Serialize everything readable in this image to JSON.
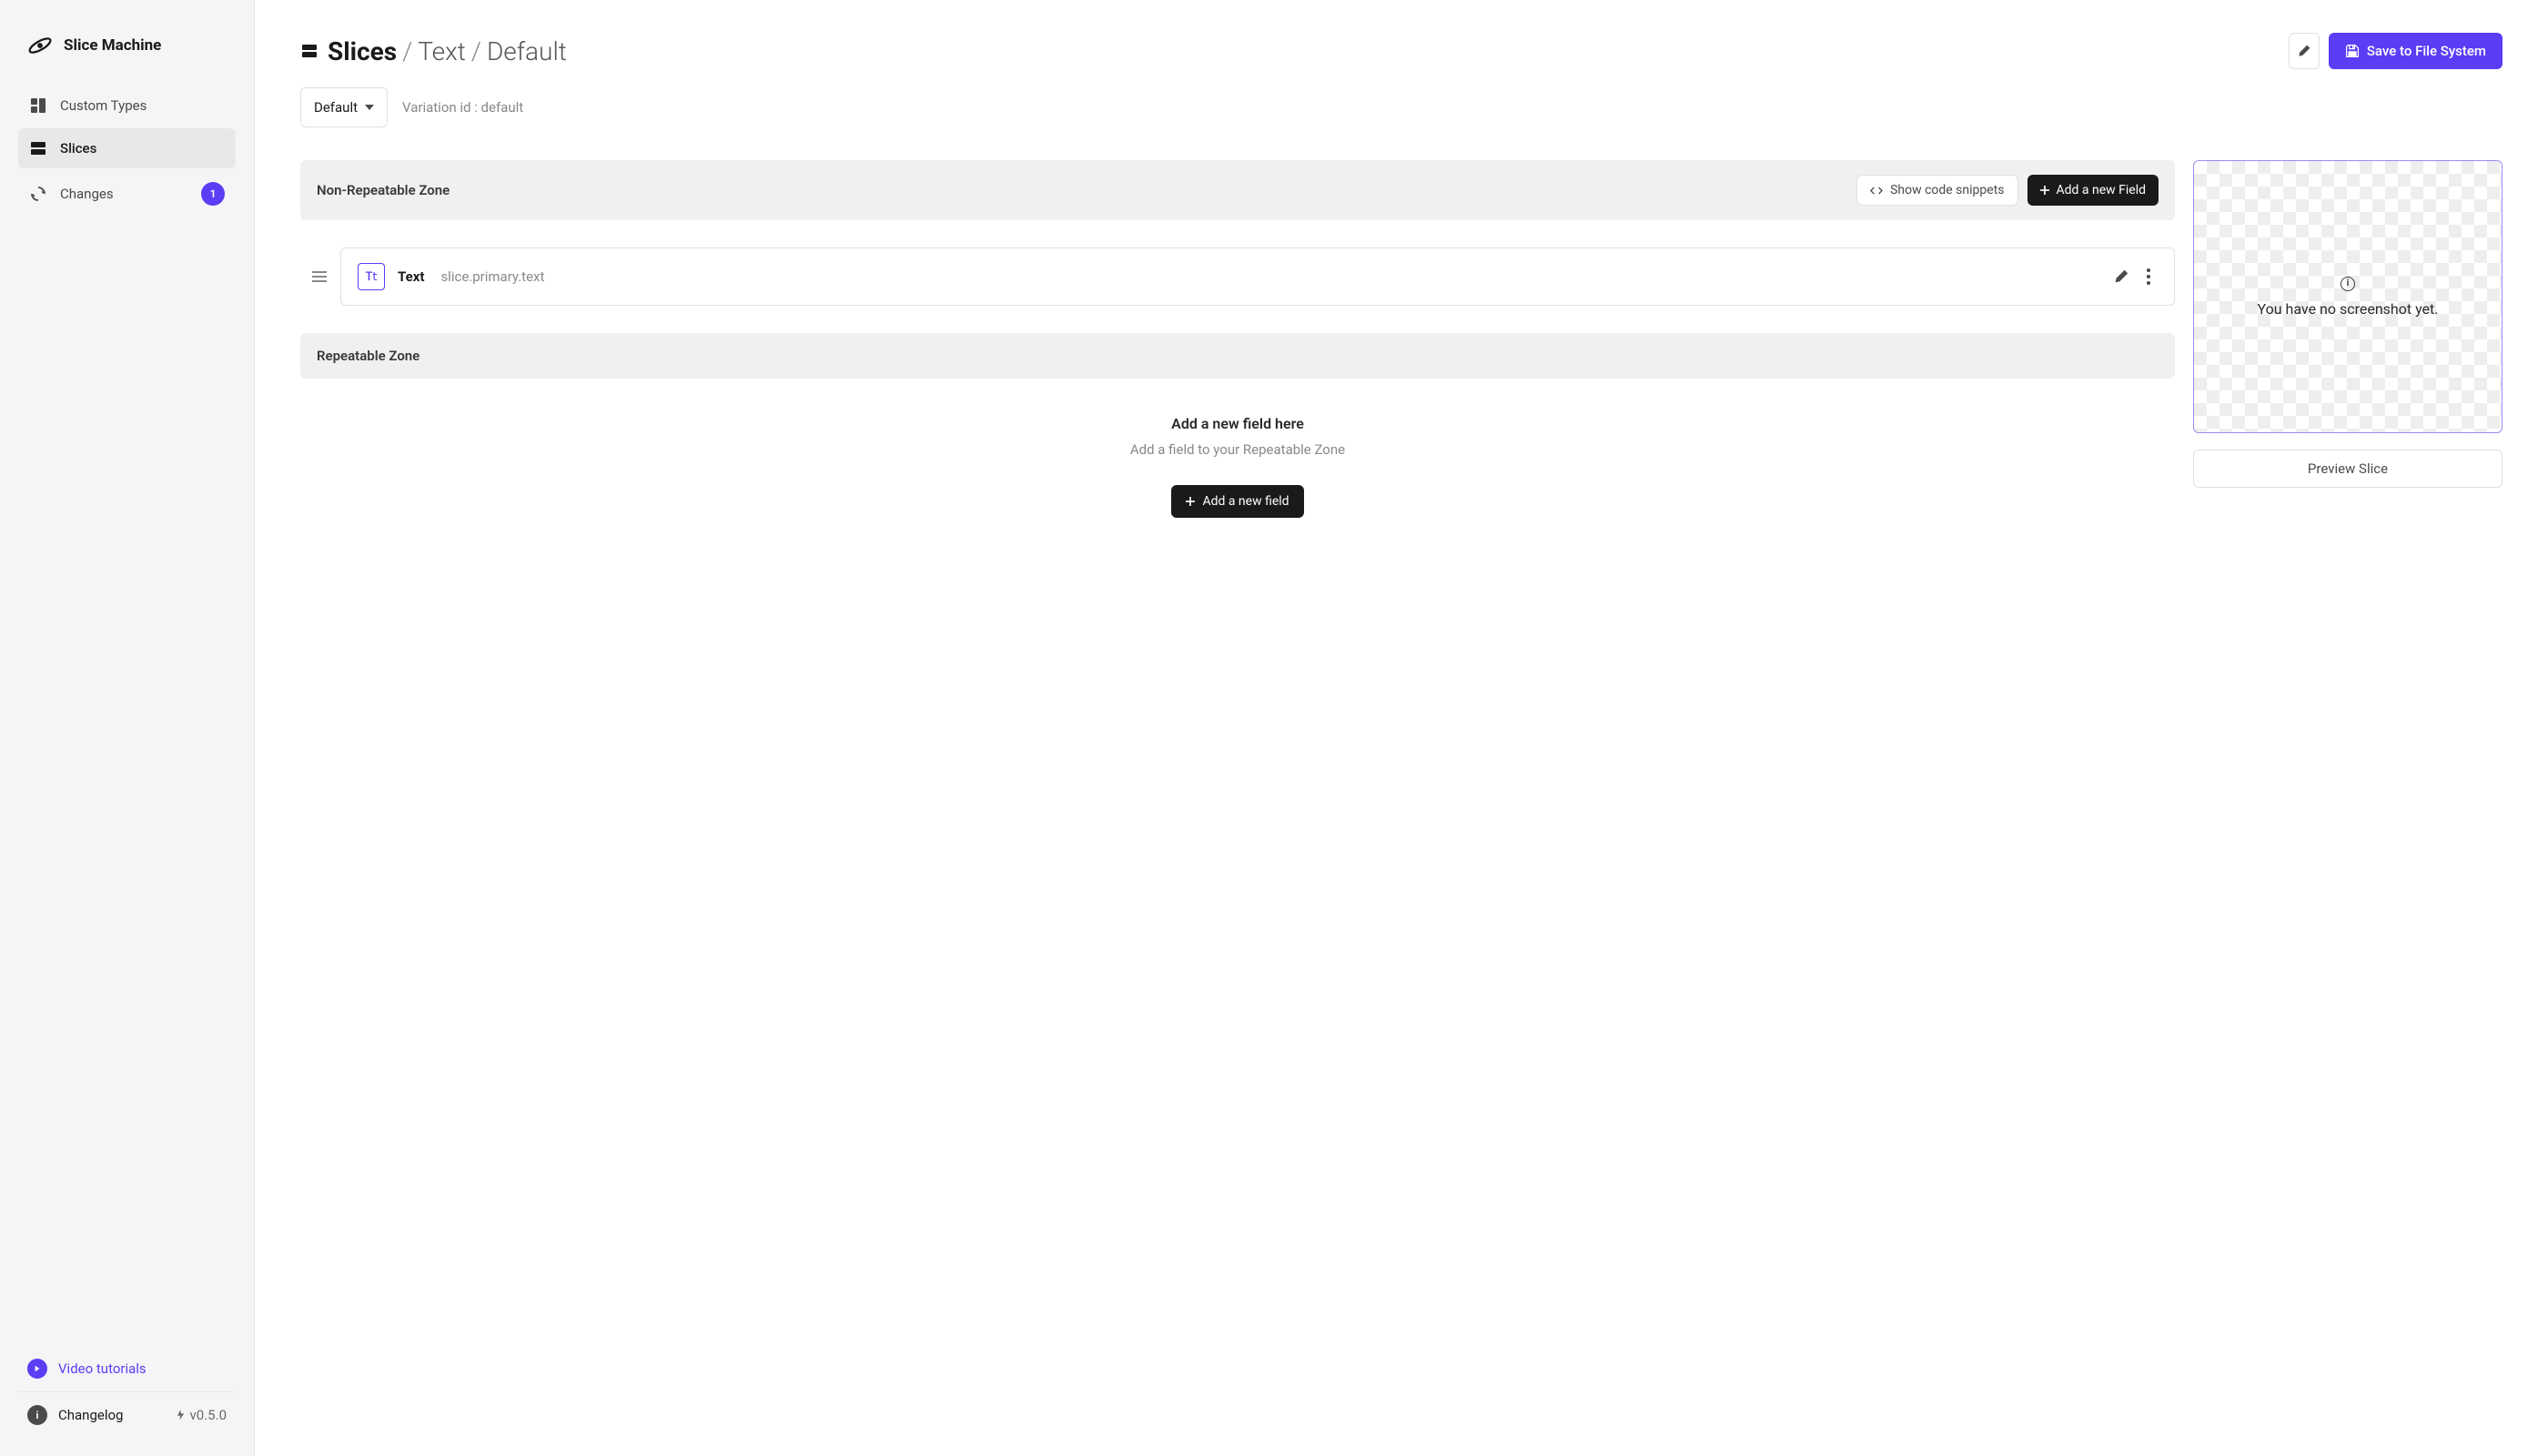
{
  "app": {
    "title": "Slice Machine"
  },
  "sidebar": {
    "items": [
      {
        "label": "Custom Types"
      },
      {
        "label": "Slices"
      },
      {
        "label": "Changes"
      }
    ],
    "changes_badge": "1",
    "tutorials_label": "Video tutorials",
    "changelog_label": "Changelog",
    "version": "v0.5.0"
  },
  "breadcrumb": {
    "root": "Slices",
    "parts": [
      "Text",
      "Default"
    ]
  },
  "header": {
    "save_button": "Save to File System"
  },
  "variation": {
    "selected": "Default",
    "id_label": "Variation id : default"
  },
  "zones": {
    "non_repeatable": {
      "title": "Non-Repeatable Zone",
      "show_snippets": "Show code snippets",
      "add_field": "Add a new Field",
      "fields": [
        {
          "name": "Text",
          "path": "slice.primary.text",
          "type": "T𝗍"
        }
      ]
    },
    "repeatable": {
      "title": "Repeatable Zone",
      "empty_title": "Add a new field here",
      "empty_subtitle": "Add a field to your Repeatable Zone",
      "add_field": "Add a new field"
    }
  },
  "preview": {
    "no_screenshot": "You have no screenshot yet.",
    "preview_button": "Preview Slice"
  }
}
